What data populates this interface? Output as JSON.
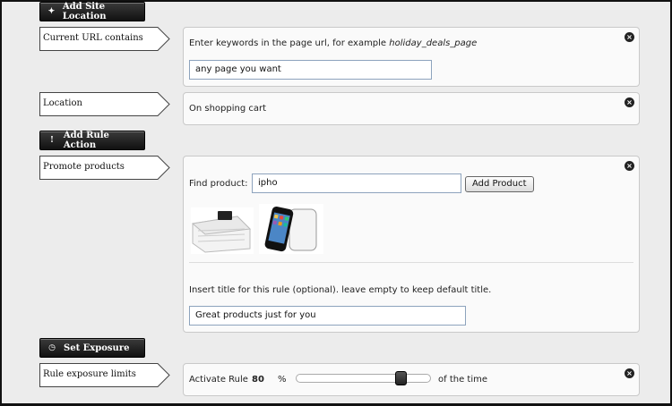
{
  "sections": {
    "site_location": {
      "title": "Add Site Location",
      "icon": "pin-icon"
    },
    "rule_action": {
      "title": "Add Rule Action",
      "icon": "exclamation-icon"
    },
    "exposure": {
      "title": "Set Exposure",
      "icon": "clock-icon"
    }
  },
  "url_rule": {
    "label": "Current URL contains",
    "hint_prefix": "Enter keywords in the page url, for example ",
    "hint_example": "holiday_deals_page",
    "value": "any page you want"
  },
  "location_rule": {
    "label": "Location",
    "value": "On shopping cart"
  },
  "promote_rule": {
    "label": "Promote products",
    "find_label": "Find product:",
    "search_value": "ipho",
    "add_button": "Add Product",
    "products": [
      {
        "name": "speaker-dock",
        "icon": "speaker-dock-image"
      },
      {
        "name": "iphone",
        "icon": "iphone-image"
      }
    ],
    "title_hint": "Insert title for this rule (optional). leave empty to keep default title.",
    "title_value": "Great products just for you"
  },
  "exposure_rule": {
    "label": "Rule exposure limits",
    "activate_label": "Activate Rule",
    "percent": "80",
    "percent_sign": "%",
    "suffix": "of the time",
    "level": 0.8
  },
  "close_glyph": "×"
}
